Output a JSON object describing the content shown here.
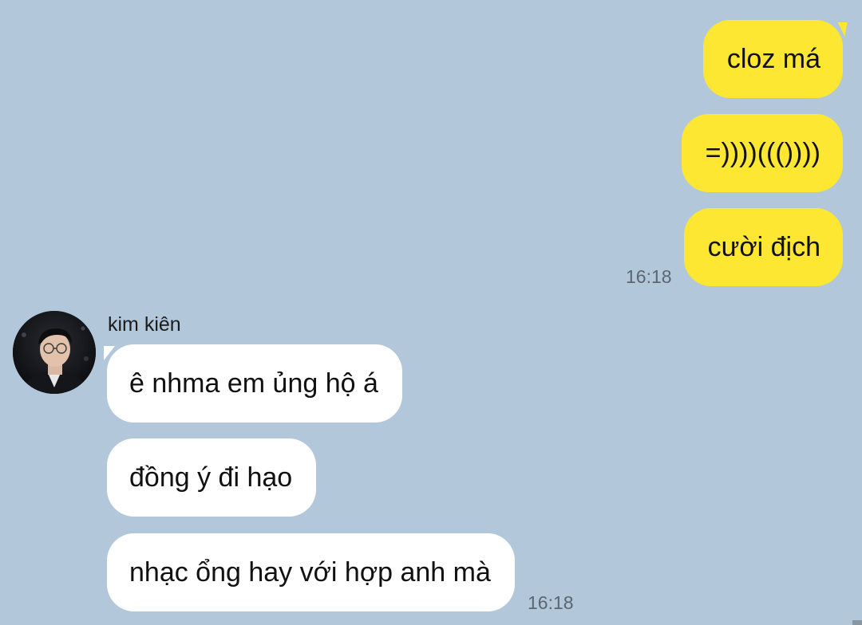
{
  "chat": {
    "outgoing": [
      {
        "text": "cloz má"
      },
      {
        "text": "=))))((())))"
      },
      {
        "text": "cười địch"
      }
    ],
    "outgoing_time": "16:18",
    "incoming": {
      "sender": "kim kiên",
      "avatar_icon": "profile-photo-avatar",
      "messages": [
        {
          "text": "ê nhma em ủng hộ á"
        },
        {
          "text": "đồng ý đi hạo"
        },
        {
          "text": "nhạc ổng hay với hợp anh mà"
        }
      ],
      "time": "16:18"
    }
  },
  "colors": {
    "background": "#b2c7da",
    "outgoing_bubble": "#fee732",
    "incoming_bubble": "#ffffff",
    "timestamp": "#5c6670"
  }
}
